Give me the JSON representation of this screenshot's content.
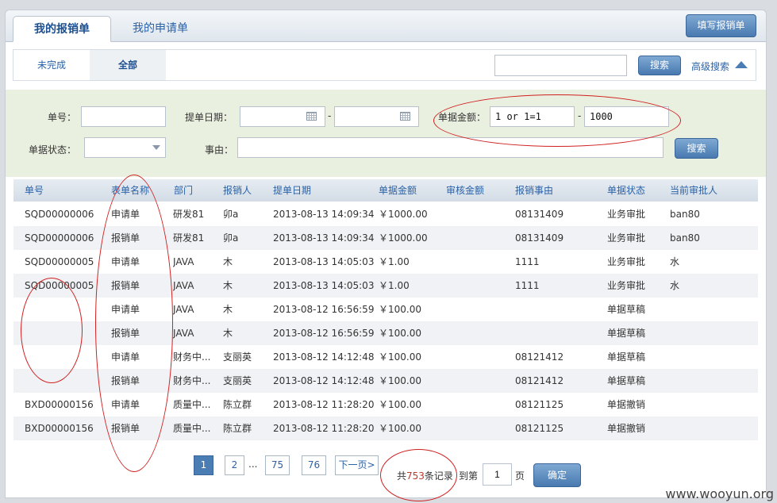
{
  "tabs": [
    "我的报销单",
    "我的申请单"
  ],
  "fill_button": "填写报销单",
  "subtabs": [
    "未完成",
    "全部"
  ],
  "search": {
    "value": "",
    "button": "搜索",
    "advanced": "高级搜索"
  },
  "filter": {
    "no_label": "单号：",
    "date_label": "提单日期：",
    "dash": "-",
    "amount_label": "单据金额：",
    "amount_from": "1 or 1=1",
    "amount_to": "1000",
    "status_label": "单据状态：",
    "reason_label": "事由：",
    "search_button": "搜索"
  },
  "table": {
    "headers": [
      "单号",
      "表单名称",
      "部门",
      "报销人",
      "提单日期",
      "单据金额",
      "审核金额",
      "报销事由",
      "单据状态",
      "当前审批人"
    ],
    "rows": [
      [
        "SQD00000006",
        "申请单",
        "研发81",
        "卯a",
        "2013-08-13 14:09:34",
        "￥1000.00",
        "",
        "08131409",
        "业务审批",
        "ban80"
      ],
      [
        "SQD00000006",
        "报销单",
        "研发81",
        "卯a",
        "2013-08-13 14:09:34",
        "￥1000.00",
        "",
        "08131409",
        "业务审批",
        "ban80"
      ],
      [
        "SQD00000005",
        "申请单",
        "JAVA",
        "木",
        "2013-08-13 14:05:03",
        "￥1.00",
        "",
        "1111",
        "业务审批",
        "水"
      ],
      [
        "SQD00000005",
        "报销单",
        "JAVA",
        "木",
        "2013-08-13 14:05:03",
        "￥1.00",
        "",
        "1111",
        "业务审批",
        "水"
      ],
      [
        "",
        "申请单",
        "JAVA",
        "木",
        "2013-08-12 16:56:59",
        "￥100.00",
        "",
        "",
        "单据草稿",
        ""
      ],
      [
        "",
        "报销单",
        "JAVA",
        "木",
        "2013-08-12 16:56:59",
        "￥100.00",
        "",
        "",
        "单据草稿",
        ""
      ],
      [
        "",
        "申请单",
        "财务中...",
        "支丽英",
        "2013-08-12 14:12:48",
        "￥100.00",
        "",
        "08121412",
        "单据草稿",
        ""
      ],
      [
        "",
        "报销单",
        "财务中...",
        "支丽英",
        "2013-08-12 14:12:48",
        "￥100.00",
        "",
        "08121412",
        "单据草稿",
        ""
      ],
      [
        "BXD00000156",
        "申请单",
        "质量中...",
        "陈立群",
        "2013-08-12 11:28:20",
        "￥100.00",
        "",
        "08121125",
        "单据撤销",
        ""
      ],
      [
        "BXD00000156",
        "报销单",
        "质量中...",
        "陈立群",
        "2013-08-12 11:28:20",
        "￥100.00",
        "",
        "08121125",
        "单据撤销",
        ""
      ]
    ]
  },
  "pager": {
    "pages": [
      "1",
      "2",
      "75",
      "76"
    ],
    "ellipsis": "...",
    "next": "下一页>",
    "total_prefix": "共",
    "total_count": "753",
    "total_suffix": "条记录",
    "goto_prefix": "到第",
    "goto_value": "1",
    "goto_suffix": "页",
    "confirm": "确定"
  },
  "watermark": "www.wooyun.org",
  "colors": {
    "accent": "#2a62a7",
    "button": "#4879b0",
    "filter_bg": "#eaf0e0",
    "annotation": "#d02020",
    "count": "#c0392b"
  }
}
